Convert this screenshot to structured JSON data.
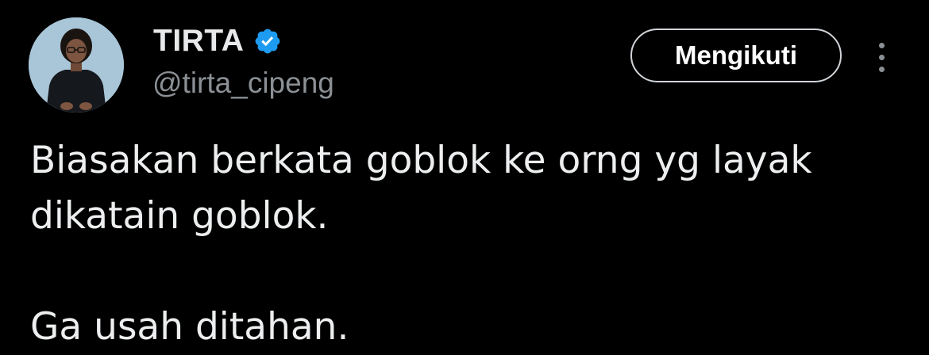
{
  "author": {
    "display_name": "TIRTA",
    "handle": "@tirta_cipeng",
    "verified": true,
    "verified_color": "#1d9bf0",
    "avatar_icon": "profile-photo"
  },
  "actions": {
    "follow_label": "Mengikuti",
    "more_icon": "vertical-ellipsis-icon"
  },
  "tweet": {
    "lines": [
      "Biasakan berkata goblok ke orng yg layak",
      "dikatain goblok.",
      "Ga usah ditahan."
    ]
  },
  "colors": {
    "background": "#000000",
    "text_primary": "#e7e9ea",
    "text_secondary": "#8b9095",
    "button_border": "#d0d4d8"
  }
}
